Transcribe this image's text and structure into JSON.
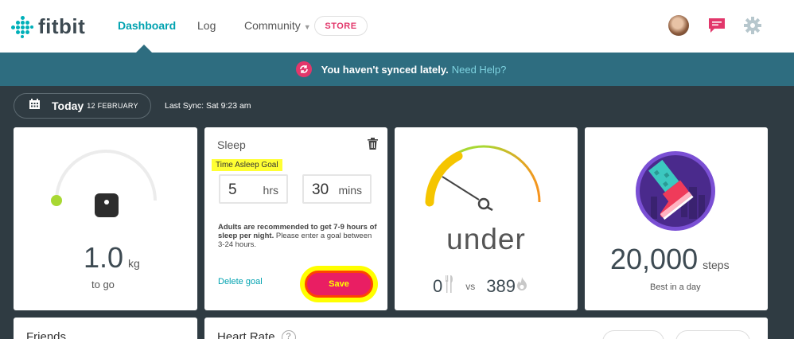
{
  "brand": {
    "name": "fitbit",
    "color": "#00b0b9"
  },
  "nav": {
    "items": [
      {
        "label": "Dashboard"
      },
      {
        "label": "Log"
      },
      {
        "label": "Community"
      }
    ],
    "store_label": "STORE"
  },
  "banner": {
    "message": "You haven't synced lately.",
    "link": "Need Help?"
  },
  "date_bar": {
    "today_label": "Today",
    "date": "12 FEBRUARY",
    "last_sync": "Last Sync: Sat 9:23 am"
  },
  "weight": {
    "value": "1.0",
    "unit": "kg",
    "sub": "to go"
  },
  "sleep": {
    "title": "Sleep",
    "goal_label": "Time Asleep Goal",
    "hours_value": "5",
    "hours_unit": "hrs",
    "mins_value": "30",
    "mins_unit": "mins",
    "desc_bold": "Adults are recommended to get 7-9 hours of sleep per night.",
    "desc_rest": " Please enter a goal between 3-24 hours.",
    "delete_label": "Delete goal",
    "save_label": "Save"
  },
  "calories": {
    "status": "under",
    "eaten": "0",
    "vs": "vs",
    "burned": "389"
  },
  "steps": {
    "value": "20,000",
    "unit": "steps",
    "sub": "Best in a day"
  },
  "friends": {
    "title": "Friends"
  },
  "heart_rate": {
    "title": "Heart Rate",
    "help": "?"
  },
  "colors": {
    "accent": "#00a2b0",
    "banner_bg": "#2e6d80",
    "page_bg": "#2f3b42",
    "alert": "#e2376b",
    "highlight": "#ffff00"
  }
}
